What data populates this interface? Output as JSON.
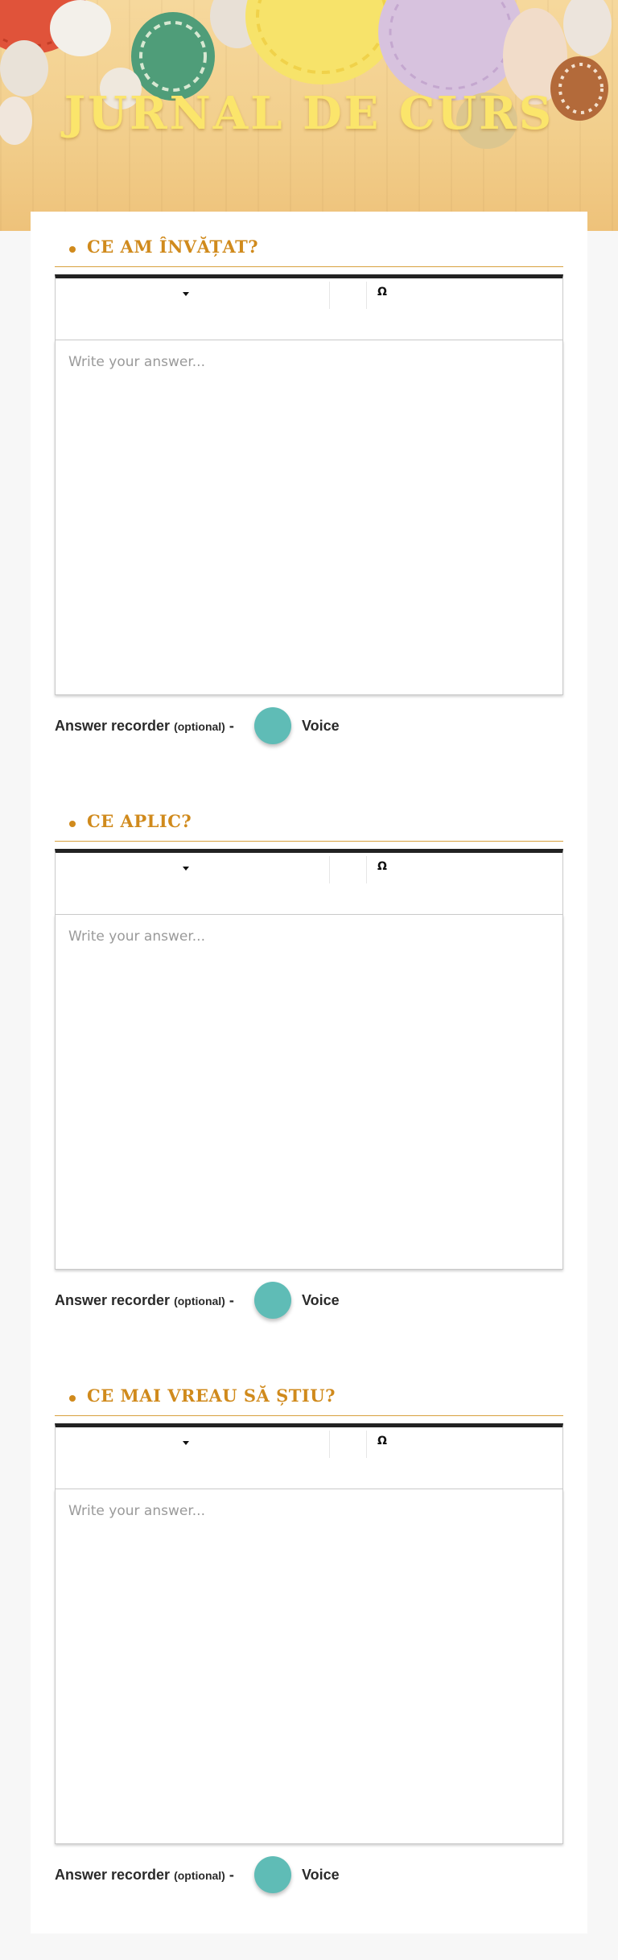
{
  "page": {
    "title": "JURNAL DE CURS"
  },
  "editor": {
    "toolbar": {
      "special_char_glyph": "Ω"
    },
    "placeholder": "Write your answer..."
  },
  "recorder": {
    "label": "Answer recorder",
    "optional": "(optional)",
    "dash": "-",
    "voice_label": "Voice"
  },
  "questions": [
    {
      "title": "CE AM ÎNVĂȚAT?"
    },
    {
      "title": "CE APLIC?"
    },
    {
      "title": "CE MAI VREAU SĂ ȘTIU?"
    }
  ],
  "colors": {
    "accent": "#d08a1c",
    "title": "#fbe56b",
    "voice_button": "#5fbcb6"
  }
}
